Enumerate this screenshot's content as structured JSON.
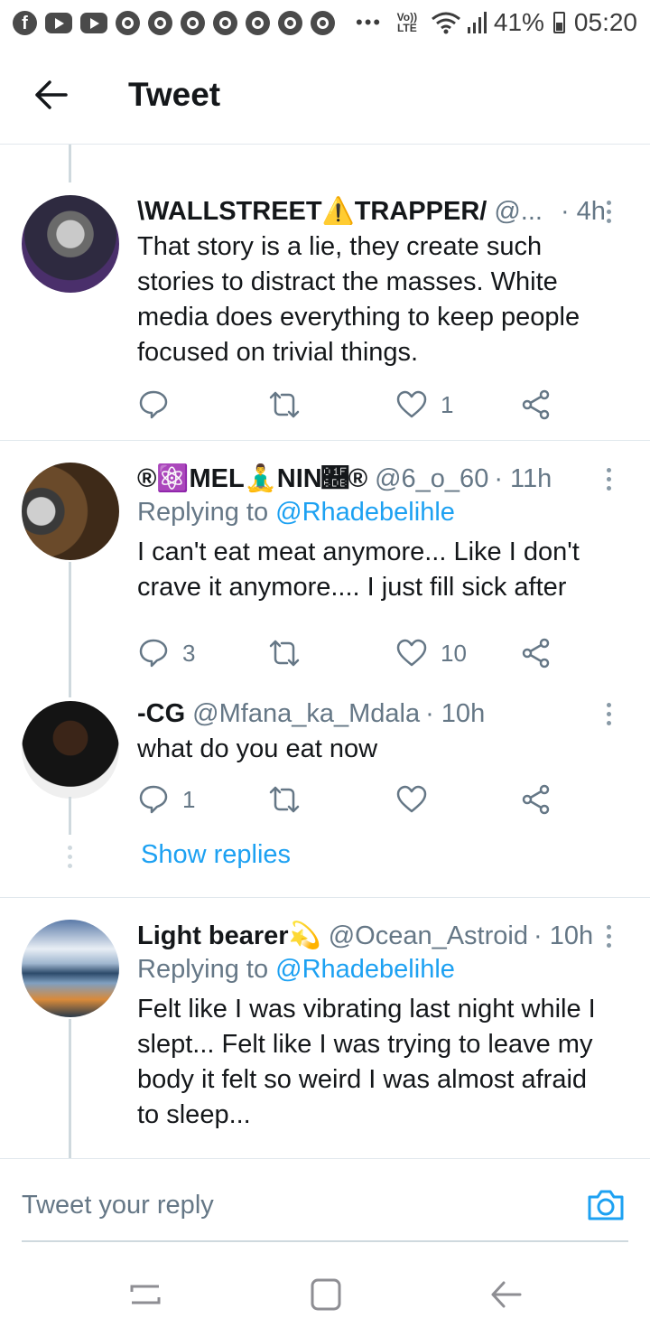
{
  "status_bar": {
    "volte": "Vo)) LTE",
    "battery": "41%",
    "time": "05:20",
    "overflow": "•••",
    "icons": [
      "facebook-icon",
      "youtube-icon",
      "youtube-icon",
      "chrome-icon",
      "chrome-icon",
      "chrome-icon",
      "chrome-icon",
      "chrome-icon",
      "chrome-icon",
      "chrome-icon"
    ]
  },
  "header": {
    "title": "Tweet"
  },
  "tweets": [
    {
      "name": "\\WALLSTREET⚠️TRAPPER/",
      "handle": "@...",
      "time": "· 4h",
      "replying_prefix": "",
      "replying_to": "",
      "text": "That story is a lie, they create such stories to distract the masses. White media does everything to keep people focused on trivial things.",
      "replies": "",
      "likes": "1"
    },
    {
      "name": "®⚛️MEL🧘‍♂️NIN🛛®",
      "handle": "@6_o_60",
      "time": "· 11h",
      "replying_prefix": "Replying to ",
      "replying_to": "@Rhadebelihle",
      "text": "I can't eat meat anymore... Like I don't crave it anymore.... I just fill sick after",
      "replies": "3",
      "likes": "10"
    },
    {
      "name": "-CG",
      "handle": "@Mfana_ka_Mdala",
      "time": "· 10h",
      "replying_prefix": "",
      "replying_to": "",
      "text": "what do you eat now",
      "replies": "1",
      "likes": ""
    },
    {
      "name": "Light bearer💫",
      "handle": "@Ocean_Astroid",
      "time": "· 10h",
      "replying_prefix": "Replying to ",
      "replying_to": "@Rhadebelihle",
      "text": "Felt like I was vibrating last night while I slept... Felt like I was trying to leave my body it felt so weird I was almost afraid to sleep...",
      "replies": "",
      "likes": ""
    }
  ],
  "show_replies": "Show replies",
  "reply_bar": {
    "placeholder": "Tweet your reply"
  },
  "colors": {
    "accent": "#1da1f2",
    "secondary_text": "#657786",
    "divider": "#e1e8ed"
  }
}
